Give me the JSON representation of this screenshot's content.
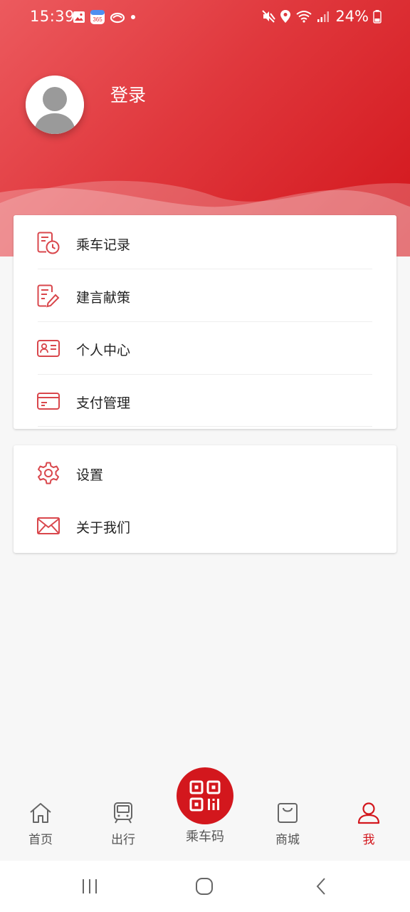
{
  "status_bar": {
    "time": "15:39",
    "battery": "24%",
    "left_icons": [
      "gallery-icon",
      "calendar-app-icon",
      "cloud-app-icon",
      "dot-icon"
    ],
    "right_icons": [
      "mute-icon",
      "location-icon",
      "wifi-icon",
      "signal-icon",
      "battery-icon"
    ]
  },
  "profile": {
    "login_label": "登录",
    "avatar_icon": "default-avatar-icon"
  },
  "menu_group_1": [
    {
      "label": "乘车记录",
      "icon": "ride-history-icon"
    },
    {
      "label": "建言献策",
      "icon": "suggestion-icon"
    },
    {
      "label": "个人中心",
      "icon": "id-card-icon"
    },
    {
      "label": "支付管理",
      "icon": "payment-card-icon"
    }
  ],
  "menu_group_2": [
    {
      "label": "设置",
      "icon": "gear-icon"
    },
    {
      "label": "关于我们",
      "icon": "mail-icon"
    }
  ],
  "bottom_nav": {
    "home": "首页",
    "travel": "出行",
    "ride_code": "乘车码",
    "mall": "商城",
    "me": "我",
    "active": "me"
  },
  "colors": {
    "accent": "#d3171d",
    "header_light": "#ec5a5e",
    "icon_red": "#d9474c"
  }
}
